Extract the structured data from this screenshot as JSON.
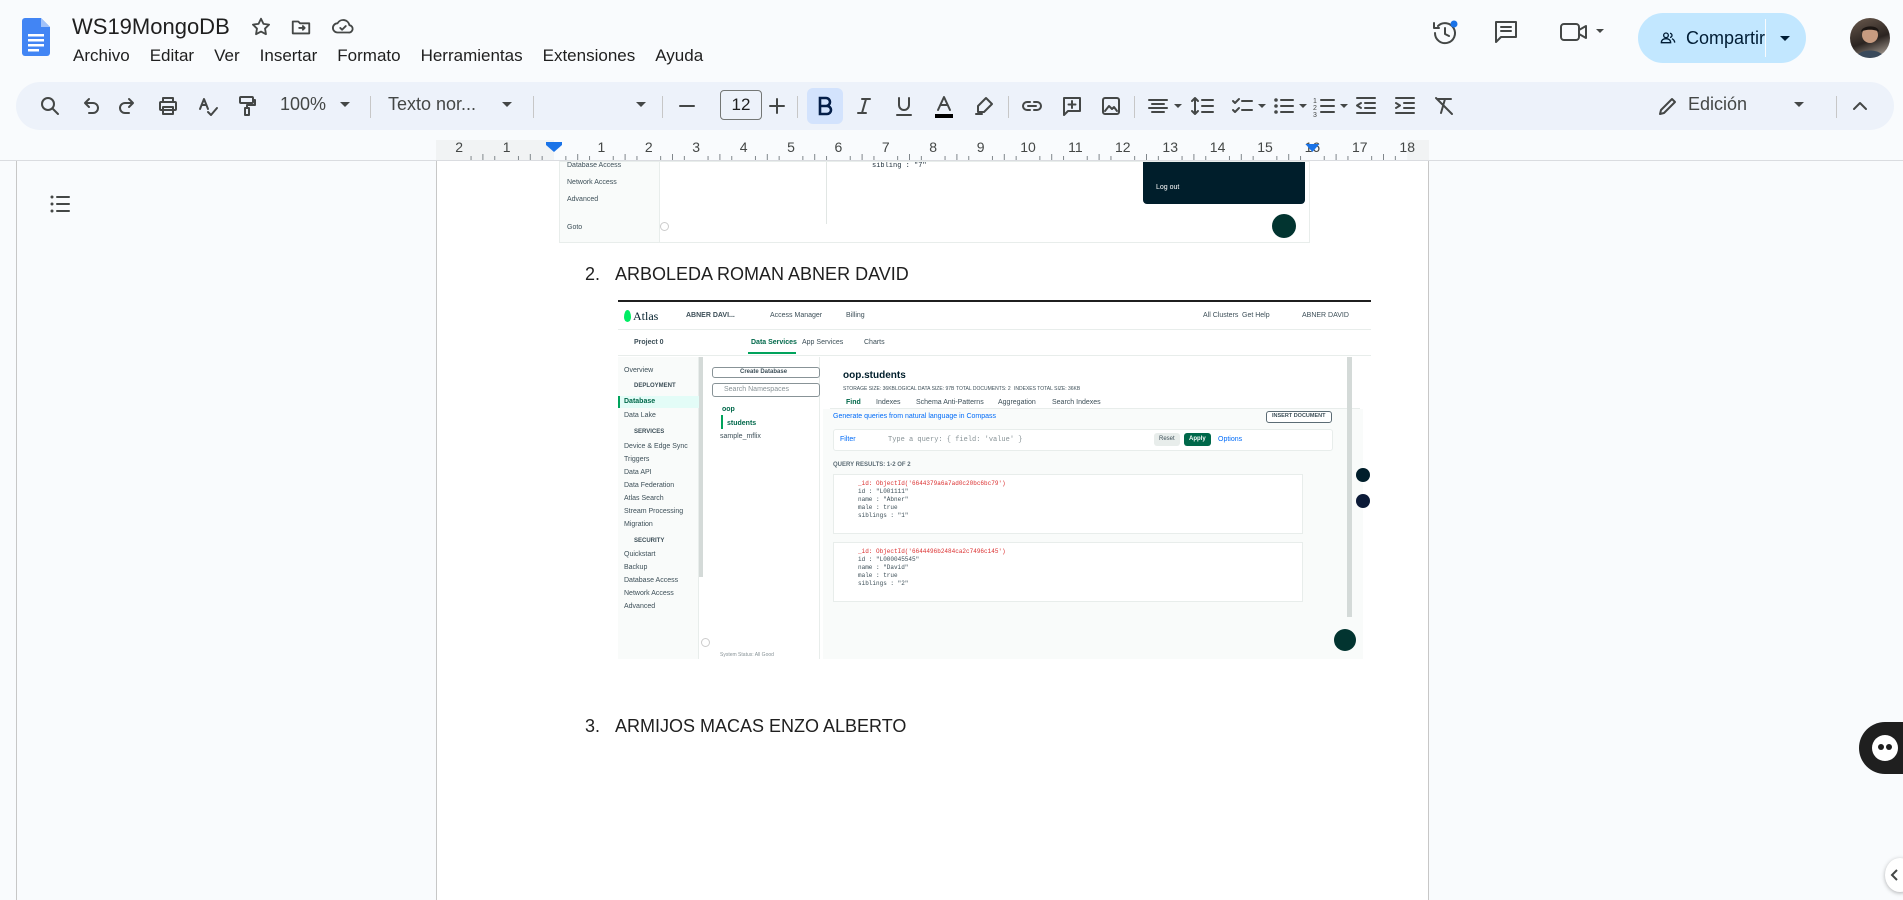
{
  "app": {
    "doc_title": "WS19MongoDB",
    "menu": [
      "Archivo",
      "Editar",
      "Ver",
      "Insertar",
      "Formato",
      "Herramientas",
      "Extensiones",
      "Ayuda"
    ],
    "share_label": "Compartir"
  },
  "toolbar": {
    "zoom": "100%",
    "style": "Texto nor...",
    "font": "",
    "font_size": "12",
    "mode": "Edición"
  },
  "ruler": {
    "left_marks": [
      "2",
      "1"
    ],
    "right_marks": [
      "1",
      "2",
      "3",
      "4",
      "5",
      "6",
      "7",
      "8",
      "9",
      "10",
      "11",
      "12",
      "13",
      "14",
      "15",
      "16",
      "17",
      "18"
    ]
  },
  "document": {
    "items": [
      {
        "num": "2.",
        "text": "ARBOLEDA ROMAN ABNER DAVID"
      },
      {
        "num": "3.",
        "text": "ARMIJOS MACAS ENZO ALBERTO"
      }
    ]
  },
  "screenshot_top": {
    "sidebar": [
      "Database Access",
      "Network Access",
      "Advanced",
      "Goto"
    ],
    "code": "sibling : \"7\"",
    "menu_item": "Log out"
  },
  "atlas": {
    "logo": "Atlas",
    "org": "ABNER DAVI...",
    "nav": [
      "Access Manager",
      "Billing"
    ],
    "right_nav": [
      "All Clusters",
      "Get Help",
      "ABNER DAVID"
    ],
    "project": "Project 0",
    "tabs": [
      "Data Services",
      "App Services",
      "Charts"
    ],
    "sidebar": {
      "overview": "Overview",
      "deployment_header": "DEPLOYMENT",
      "deployment": [
        "Database",
        "Data Lake"
      ],
      "services_header": "SERVICES",
      "services": [
        "Device & Edge Sync",
        "Triggers",
        "Data API",
        "Data Federation",
        "Atlas Search",
        "Stream Processing",
        "Migration"
      ],
      "security_header": "SECURITY",
      "security": [
        "Quickstart",
        "Backup",
        "Database Access",
        "Network Access",
        "Advanced"
      ]
    },
    "create_db": "Create Database",
    "search_ns": "Search Namespaces",
    "tree": {
      "db": "oop",
      "collection": "students",
      "other": "sample_mflix"
    },
    "collection_title": "oop.students",
    "stats": [
      "STORAGE SIZE: 36KB",
      "LOGICAL DATA SIZE: 97B",
      "TOTAL DOCUMENTS: 2",
      "INDEXES TOTAL SIZE: 36KB"
    ],
    "col_tabs": [
      "Find",
      "Indexes",
      "Schema Anti-Patterns",
      "Aggregation",
      "Search Indexes"
    ],
    "generate": "Generate queries from natural language in Compass",
    "insert_doc": "INSERT DOCUMENT",
    "filter_label": "Filter",
    "filter_placeholder": "Type a query: { field: 'value' }",
    "reset": "Reset",
    "apply": "Apply",
    "options": "Options",
    "results": "QUERY RESULTS: 1-2 OF 2",
    "docs": [
      [
        "_id: ObjectId('6644379a6a7ad0c20bc6bc79')",
        "id : \"L001111\"",
        "name : \"Abner\"",
        "male : true",
        "siblings : \"1\""
      ],
      [
        "_id: ObjectId('6644496b2484ca2c7496c145')",
        "id : \"L000045545\"",
        "name : \"David\"",
        "male : true",
        "siblings : \"2\""
      ]
    ],
    "status": "System Status: All Good"
  }
}
